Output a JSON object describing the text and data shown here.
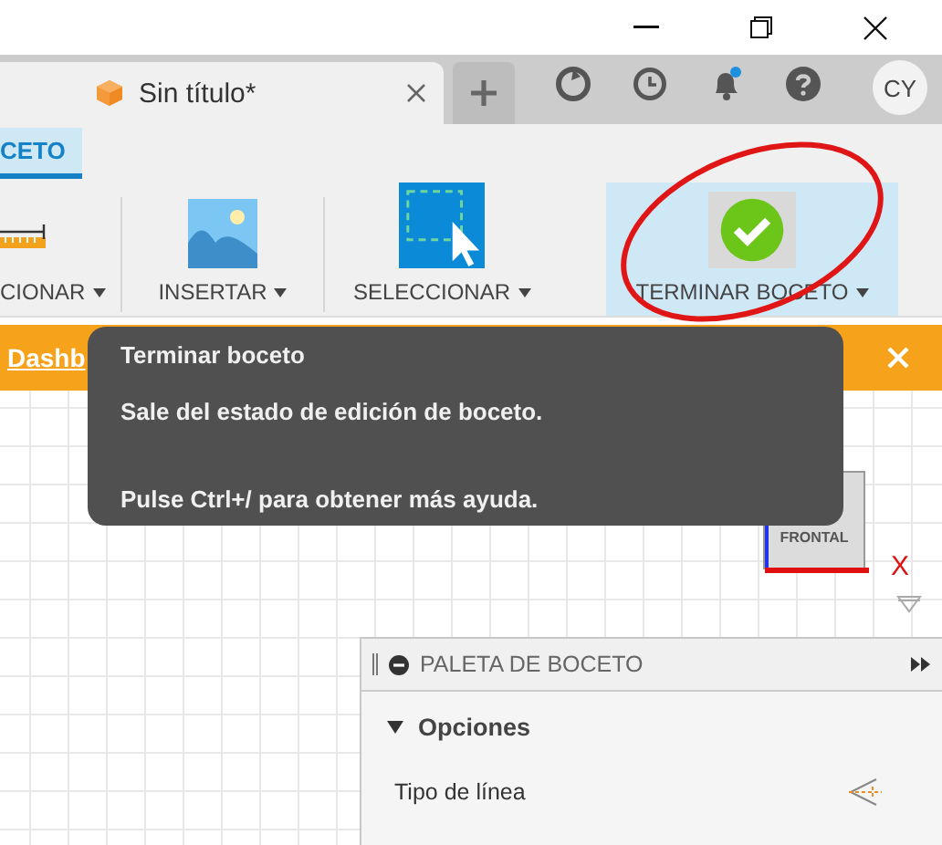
{
  "document_tab": {
    "title": "Sin título*"
  },
  "user_badge": "CY",
  "ribbon_tab": {
    "label": "CETO",
    "selected": true
  },
  "tools": [
    {
      "kind": "ruler",
      "label": "CIONAR",
      "selected": false
    },
    {
      "kind": "image",
      "label": "INSERTAR",
      "selected": false
    },
    {
      "kind": "select",
      "label": "SELECCIONAR",
      "selected": false
    },
    {
      "kind": "check",
      "label": "TERMINAR BOCETO",
      "selected": true
    }
  ],
  "banner": {
    "link": "Dashb"
  },
  "tooltip": {
    "title": "Terminar boceto",
    "lines": [
      "Sale del estado de edición de boceto.",
      "Pulse Ctrl+/ para obtener más ayuda."
    ]
  },
  "view_cube": {
    "face": "FRONTAL",
    "axis": "X"
  },
  "palette": {
    "title": "PALETA DE BOCETO",
    "section": {
      "label": "Opciones",
      "expanded": true
    },
    "rows": [
      {
        "label": "Tipo de línea"
      }
    ]
  }
}
